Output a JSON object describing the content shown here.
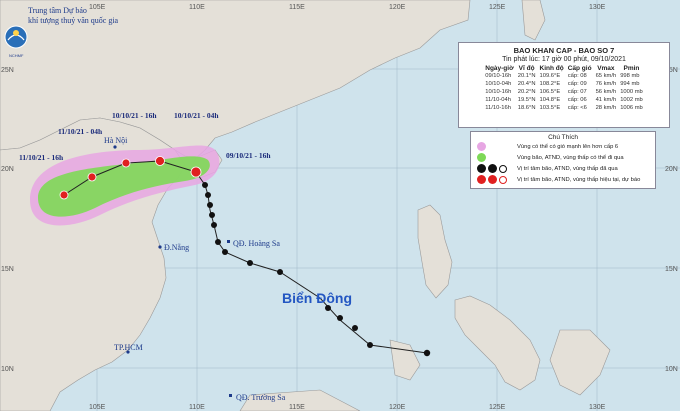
{
  "header": {
    "line1": "Trung tâm Dự báo",
    "line2": "khí tượng thuỷ văn quốc gia",
    "logo_text": "NCHMF"
  },
  "info_box": {
    "title": "BAO KHAN CAP - BAO SO 7",
    "issued": "Tin phát lúc: 17 giờ 00 phút, 09/10/2021",
    "columns": [
      "Ngày-giờ",
      "Vĩ độ",
      "Kinh độ",
      "Cấp gió",
      "Vmax",
      "Pmin"
    ],
    "rows": [
      [
        "09/10-16h",
        "20.1°N",
        "109.6°E",
        "cấp: 08",
        "65 km/h",
        "998 mb"
      ],
      [
        "10/10-04h",
        "20.4°N",
        "108.2°E",
        "cấp: 09",
        "76 km/h",
        "994 mb"
      ],
      [
        "10/10-16h",
        "20.2°N",
        "106.5°E",
        "cấp: 07",
        "56 km/h",
        "1000 mb"
      ],
      [
        "11/10-04h",
        "19.5°N",
        "104.8°E",
        "cấp: 06",
        "41 km/h",
        "1002 mb"
      ],
      [
        "11/10-16h",
        "18.6°N",
        "103.5°E",
        "cấp: <6",
        "28 km/h",
        "1006 mb"
      ]
    ]
  },
  "legend": {
    "title": "Chú Thích",
    "items": [
      {
        "text": "Vùng có thể có gió mạnh lên hơn cấp 6",
        "color": "#e7a6e3"
      },
      {
        "text": "Vùng bão, ATND, vùng thấp có thể đi qua",
        "color": "#7ed957"
      },
      {
        "text": "Vị trí tâm bão, ATND, vùng thấp đã qua",
        "color": "#000000"
      },
      {
        "text": "Vị trí tâm bão, ATND, vùng thấp hiệu tại, dự báo",
        "color": "#e02020"
      }
    ]
  },
  "map": {
    "lon_ticks": [
      "105E",
      "110E",
      "115E",
      "120E",
      "125E",
      "130E"
    ],
    "lat_ticks": [
      "25N",
      "20N",
      "15N",
      "10N"
    ],
    "places": {
      "hanoi": "Hà Nội",
      "danang": "Đ.Nẵng",
      "hoangsa": "QĐ. Hoàng Sa",
      "hcm": "TP.HCM",
      "truongsa": "QĐ. Trường Sa",
      "sea": "Biển Đông"
    },
    "track_dates": {
      "d1": "11/10/21 - 16h",
      "d2": "11/10/21 - 04h",
      "d3": "10/10/21 - 16h",
      "d4": "10/10/21 - 04h",
      "d5": "09/10/21 - 16h"
    },
    "colors": {
      "sea": "#cfe3ec",
      "land": "#e4e0d8",
      "wind_zone": "#e7a6e3",
      "storm_zone": "#7ed957",
      "forecast": "#e02020",
      "past": "#000000"
    }
  }
}
